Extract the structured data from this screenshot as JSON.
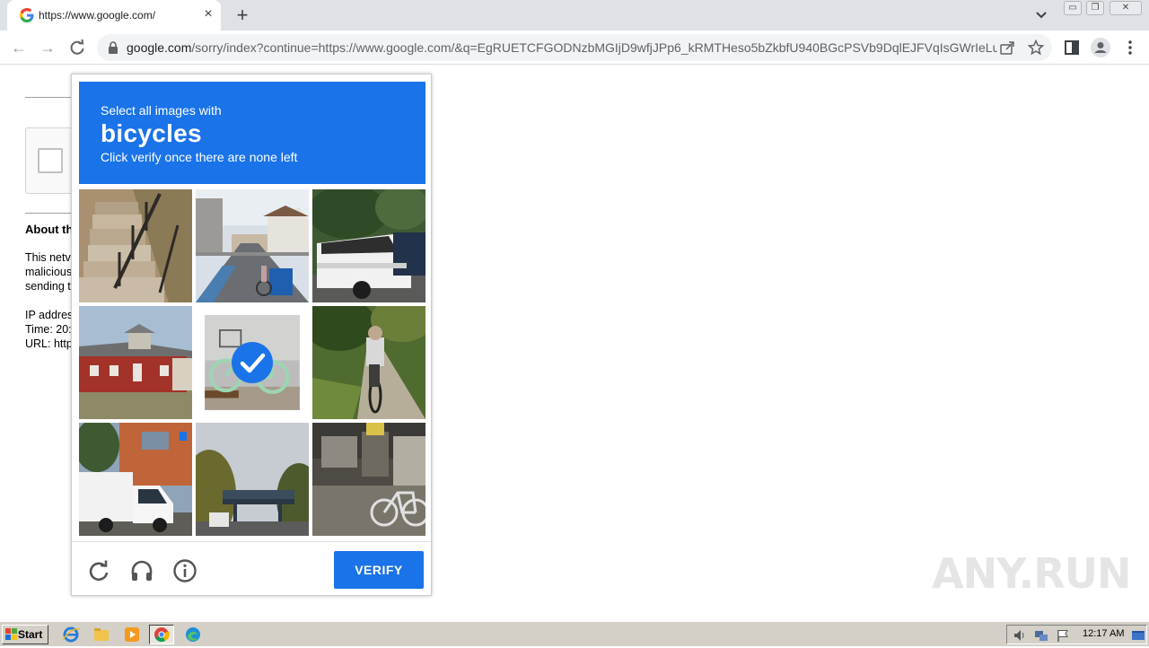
{
  "browser": {
    "tab_title": "https://www.google.com/",
    "url_host": "google.com",
    "url_rest": "/sorry/index?continue=https://www.google.com/&q=EgRUETCFGODNzbMGIjD9wfjJPp6_kRMTHeso5bZkbfU940BGcPSVb9DqlEJFVqIsGWrIeLui..."
  },
  "page": {
    "about_title": "About th",
    "lines": [
      "This netv",
      "malicious",
      "sending t",
      "IP addres",
      "Time: 20:",
      "URL: http"
    ]
  },
  "challenge": {
    "instruction_line1": "Select all images with",
    "keyword": "bicycles",
    "instruction_line2": "Click verify once there are none left",
    "verify_label": "VERIFY",
    "accent_color": "#1a73e8",
    "tiles": [
      {
        "subject": "stairs",
        "selected": false
      },
      {
        "subject": "street-with-cyclist",
        "selected": false
      },
      {
        "subject": "pickup-truck",
        "selected": false
      },
      {
        "subject": "red-house",
        "selected": false
      },
      {
        "subject": "bicycle",
        "selected": true
      },
      {
        "subject": "person-cycling",
        "selected": false
      },
      {
        "subject": "delivery-truck",
        "selected": false
      },
      {
        "subject": "bridge",
        "selected": false
      },
      {
        "subject": "parked-bicycle",
        "selected": false
      }
    ]
  },
  "watermark": "ANY.RUN",
  "taskbar": {
    "start_label": "Start",
    "clock": "12:17 AM"
  }
}
